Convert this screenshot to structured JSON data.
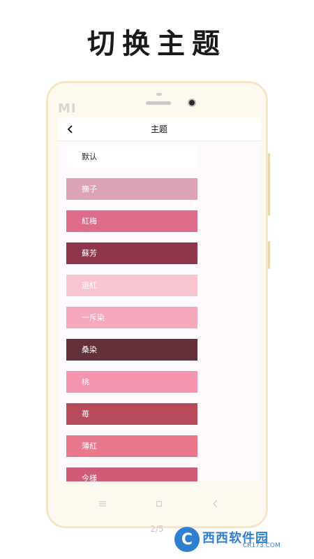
{
  "promo": {
    "title": "切换主题"
  },
  "device": {
    "brand": "MI"
  },
  "app": {
    "title": "主题",
    "themes": [
      {
        "label": "默认",
        "color": "#ffffff",
        "text_color": "#222222"
      },
      {
        "label": "撫子",
        "color": "#dca3b4",
        "text_color": "#ffffff"
      },
      {
        "label": "紅梅",
        "color": "#dd6b8a",
        "text_color": "#ffffff"
      },
      {
        "label": "蘇芳",
        "color": "#8e354b",
        "text_color": "#ffffff"
      },
      {
        "label": "退紅",
        "color": "#f6c5cf",
        "text_color": "#ffffff"
      },
      {
        "label": "一斥染",
        "color": "#f6a9bd",
        "text_color": "#ffffff"
      },
      {
        "label": "桑染",
        "color": "#64313a",
        "text_color": "#ffffff"
      },
      {
        "label": "桃",
        "color": "#f494ae",
        "text_color": "#ffffff"
      },
      {
        "label": "苺",
        "color": "#b74a5b",
        "text_color": "#ffffff"
      },
      {
        "label": "薄紅",
        "color": "#e9788c",
        "text_color": "#ffffff"
      },
      {
        "label": "今様",
        "color": "#d15a76",
        "text_color": "#ffffff"
      }
    ]
  },
  "pager": {
    "text": "2/5"
  },
  "watermark": {
    "logo": "C",
    "name": "西西软件园",
    "domain": "CR173.COM"
  }
}
